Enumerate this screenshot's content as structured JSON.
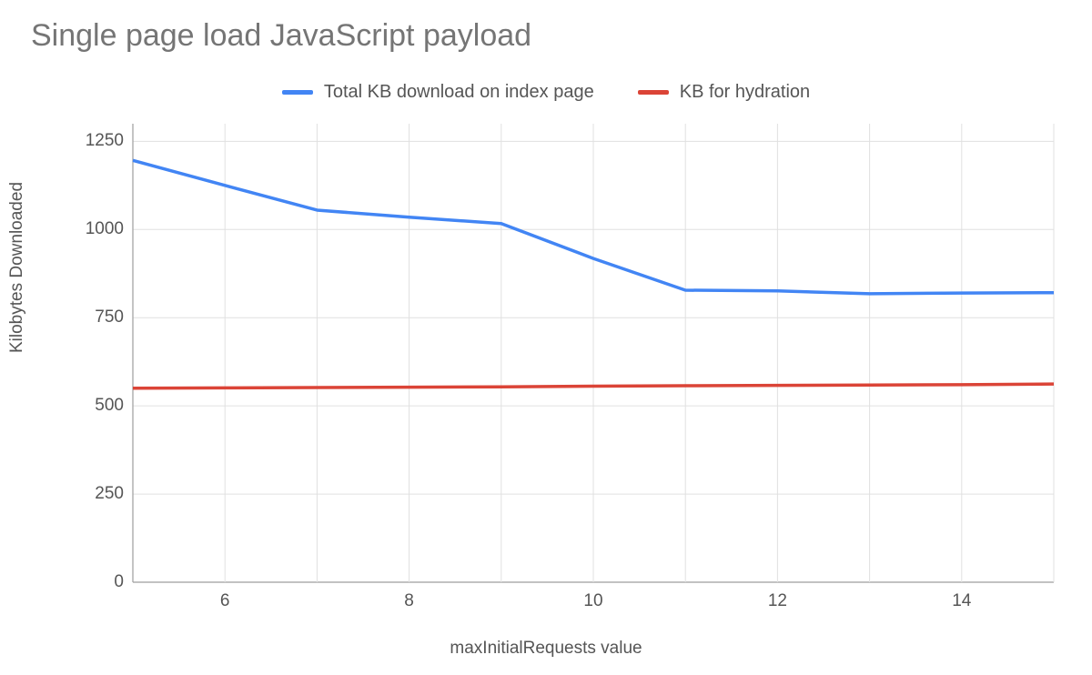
{
  "chart_data": {
    "type": "line",
    "title": "Single page load JavaScript payload",
    "xlabel": "maxInitialRequests value",
    "ylabel": "Kilobytes Downloaded",
    "x": [
      5,
      6,
      7,
      8,
      9,
      10,
      11,
      12,
      13,
      14,
      15
    ],
    "xticks": [
      6,
      8,
      10,
      12,
      14
    ],
    "ylim": [
      0,
      1300
    ],
    "yticks": [
      0,
      250,
      500,
      750,
      1000,
      1250
    ],
    "grid": true,
    "legend_position": "top",
    "series": [
      {
        "name": "Total KB download on index page",
        "color": "#4285f4",
        "values": [
          1196,
          1125,
          1055,
          1035,
          1017,
          918,
          828,
          826,
          818,
          820,
          821
        ]
      },
      {
        "name": "KB for hydration",
        "color": "#db4437",
        "values": [
          550,
          551,
          552,
          553,
          554,
          556,
          557,
          558,
          559,
          560,
          562
        ]
      }
    ]
  }
}
